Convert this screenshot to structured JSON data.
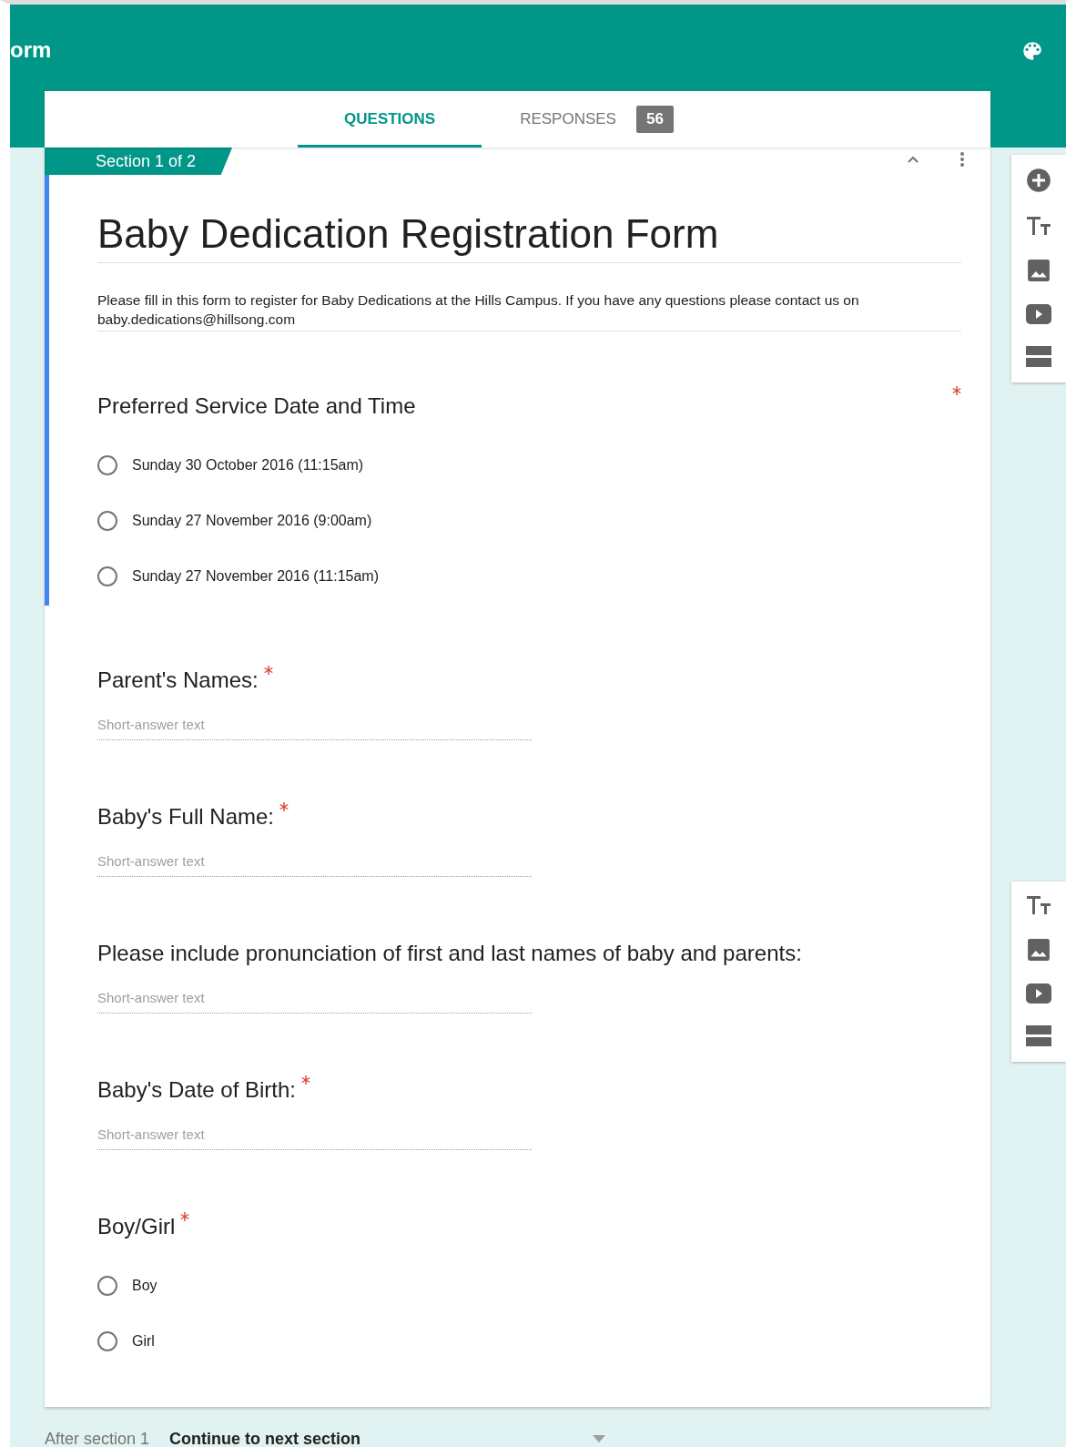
{
  "header": {
    "title": "orm"
  },
  "tabs": [
    {
      "label": "QUESTIONS",
      "selected": true
    },
    {
      "label": "RESPONSES",
      "selected": false,
      "badge": "56"
    }
  ],
  "section_tag": "Section 1 of 2",
  "form": {
    "title": "Baby Dedication Registration Form",
    "description": "Please fill in this form to register for Baby Dedications at the Hills Campus.  If you have any questions please contact us on baby.dedications@hillsong.com",
    "focused": true
  },
  "questions": [
    {
      "kind": "radio",
      "title": "Preferred Service Date and Time",
      "required": true,
      "star_at_end": true,
      "focused": true,
      "options": [
        {
          "label": "Sunday 30 October 2016 (11:15am)",
          "selected": false
        },
        {
          "label": "Sunday 27 November 2016 (9:00am)",
          "selected": false
        },
        {
          "label": "Sunday 27 November 2016 (11:15am)",
          "selected": false
        }
      ]
    },
    {
      "kind": "short",
      "title": "Parent's Names:",
      "required": true,
      "star_at_end": false,
      "focused": false,
      "placeholder": "Short-answer text"
    },
    {
      "kind": "short",
      "title": "Baby's Full Name:",
      "required": true,
      "star_at_end": false,
      "focused": false,
      "placeholder": "Short-answer text"
    },
    {
      "kind": "short",
      "title": "Please include pronunciation of first and last names of baby and parents:",
      "required": false,
      "focused": false,
      "placeholder": "Short-answer text"
    },
    {
      "kind": "short",
      "title": "Baby's Date of Birth:",
      "required": true,
      "star_at_end": false,
      "focused": false,
      "placeholder": "Short-answer text"
    },
    {
      "kind": "radio",
      "title": "Boy/Girl",
      "required": true,
      "star_at_end": false,
      "focused": false,
      "options": [
        {
          "label": "Boy",
          "selected": false
        },
        {
          "label": "Girl",
          "selected": false
        }
      ]
    }
  ],
  "toolbars": [
    {
      "tools": [
        {
          "kind": "add"
        },
        {
          "kind": "title"
        },
        {
          "kind": "image"
        },
        {
          "kind": "video"
        },
        {
          "kind": "section"
        }
      ]
    },
    {
      "tools": [
        {
          "kind": "title"
        },
        {
          "kind": "image"
        },
        {
          "kind": "video"
        },
        {
          "kind": "section"
        }
      ]
    }
  ],
  "footer": {
    "label": "After section 1",
    "value": "Continue to next section"
  }
}
